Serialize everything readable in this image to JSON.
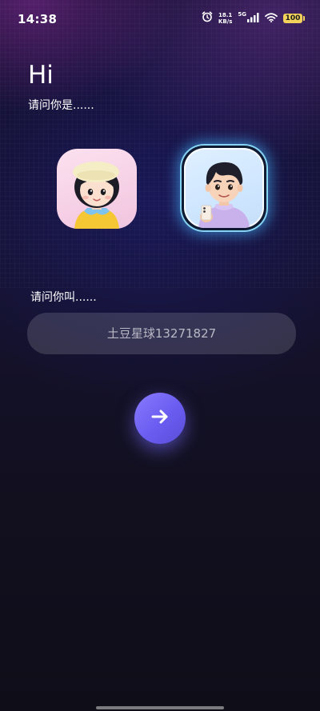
{
  "status_bar": {
    "time": "14:38",
    "net_speed_value": "18.1",
    "net_speed_unit": "KB/s",
    "network": "5G",
    "battery": "100",
    "icons": [
      "alarm-icon",
      "signal-icon",
      "wifi-icon",
      "battery-icon"
    ]
  },
  "greeting": "Hi",
  "role_question": "请问你是......",
  "avatars": [
    {
      "name": "girl-avatar",
      "selected": false
    },
    {
      "name": "boy-avatar",
      "selected": true
    }
  ],
  "name_question": "请问你叫......",
  "name_input": {
    "placeholder": "土豆星球13271827",
    "value": ""
  },
  "next_button": {
    "icon": "arrow-right-icon"
  },
  "colors": {
    "accent": "#6a5cf0",
    "selected_glow": "#46b4ff",
    "battery": "#f2d25a"
  }
}
